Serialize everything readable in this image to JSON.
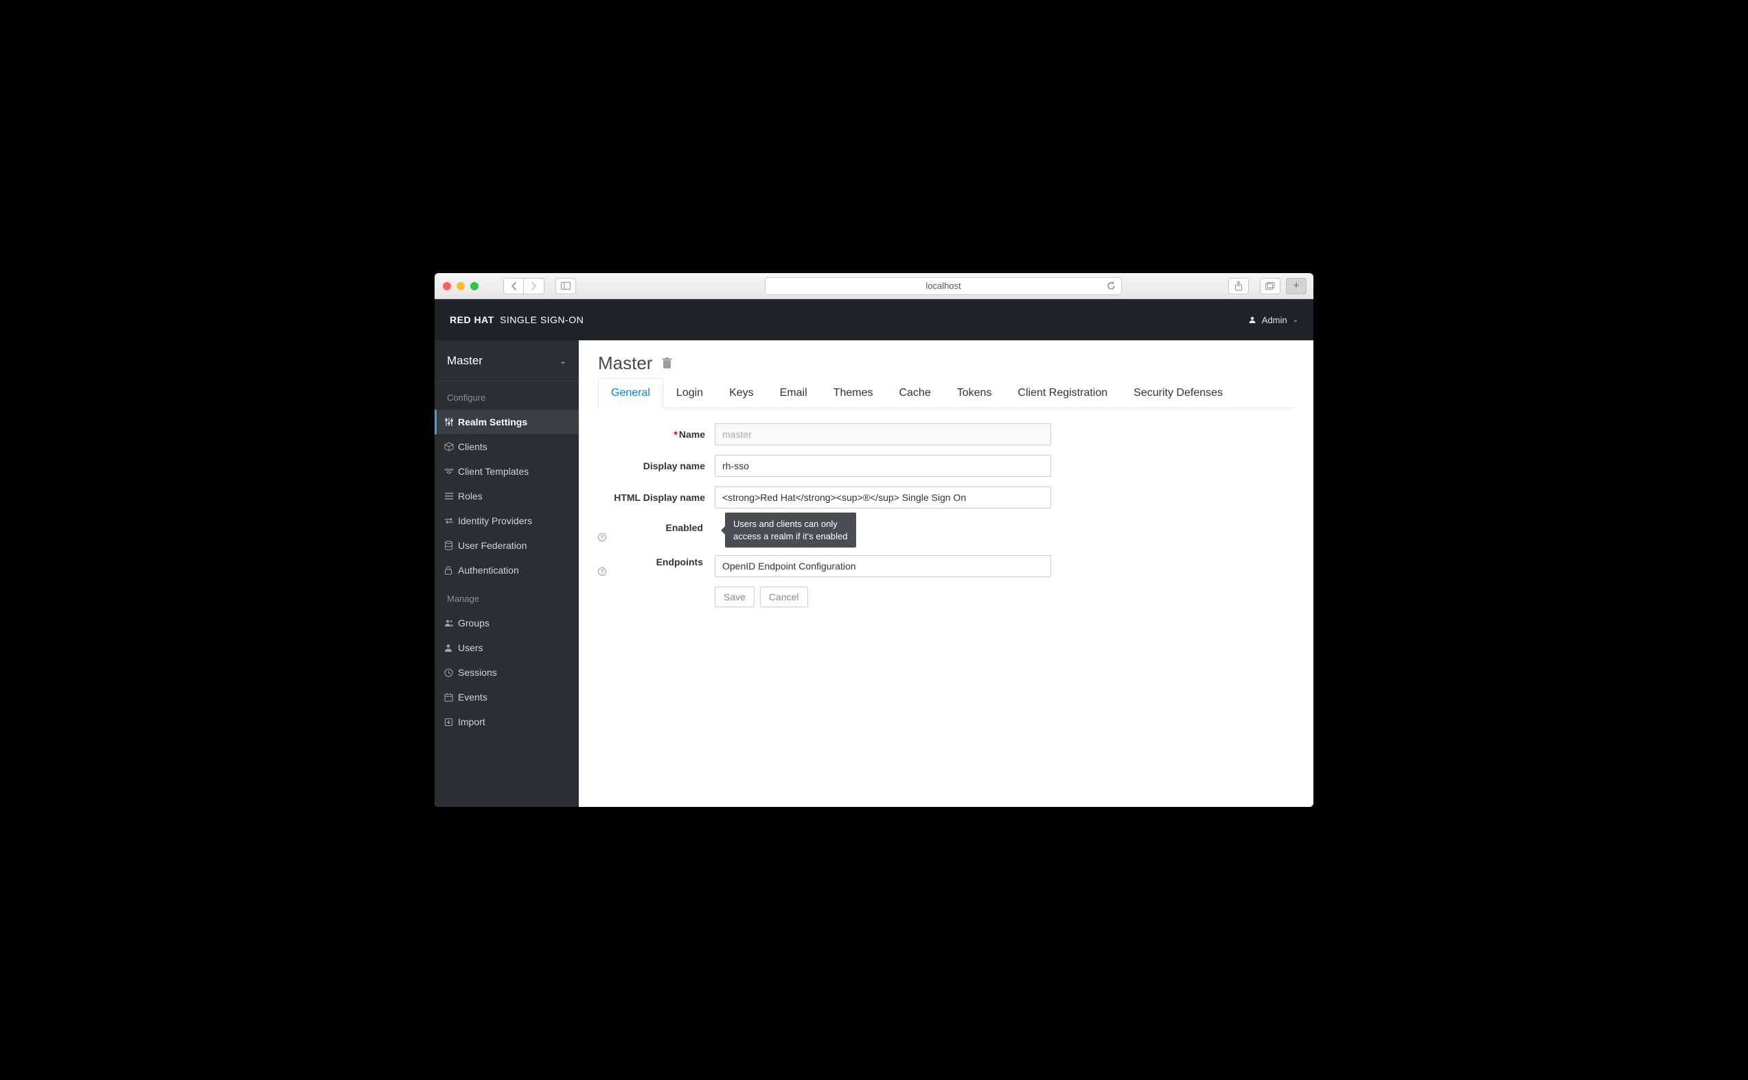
{
  "browser": {
    "address": "localhost"
  },
  "header": {
    "brand_prefix": "RED HAT",
    "brand_suffix": "SINGLE SIGN-ON",
    "user": "Admin"
  },
  "sidebar": {
    "realm": "Master",
    "sections": [
      {
        "title": "Configure",
        "items": [
          {
            "label": "Realm Settings",
            "icon": "sliders",
            "active": true
          },
          {
            "label": "Clients",
            "icon": "cube"
          },
          {
            "label": "Client Templates",
            "icon": "cubes"
          },
          {
            "label": "Roles",
            "icon": "list"
          },
          {
            "label": "Identity Providers",
            "icon": "exchange"
          },
          {
            "label": "User Federation",
            "icon": "database"
          },
          {
            "label": "Authentication",
            "icon": "lock"
          }
        ]
      },
      {
        "title": "Manage",
        "items": [
          {
            "label": "Groups",
            "icon": "group"
          },
          {
            "label": "Users",
            "icon": "user"
          },
          {
            "label": "Sessions",
            "icon": "clock"
          },
          {
            "label": "Events",
            "icon": "calendar"
          },
          {
            "label": "Import",
            "icon": "import"
          }
        ]
      }
    ]
  },
  "page": {
    "title": "Master",
    "tabs": [
      "General",
      "Login",
      "Keys",
      "Email",
      "Themes",
      "Cache",
      "Tokens",
      "Client Registration",
      "Security Defenses"
    ],
    "active_tab": 0,
    "form": {
      "name": {
        "label": "Name",
        "required": true,
        "placeholder": "master",
        "value": ""
      },
      "display_name": {
        "label": "Display name",
        "value": "rh-sso"
      },
      "html_display_name": {
        "label": "HTML Display name",
        "value": "<strong>Red Hat</strong><sup>®</sup> Single Sign On"
      },
      "enabled": {
        "label": "Enabled",
        "tooltip": "Users and clients can only\naccess a realm if it's enabled"
      },
      "endpoints": {
        "label": "Endpoints",
        "value": "OpenID Endpoint Configuration"
      },
      "buttons": {
        "save": "Save",
        "cancel": "Cancel"
      }
    }
  }
}
